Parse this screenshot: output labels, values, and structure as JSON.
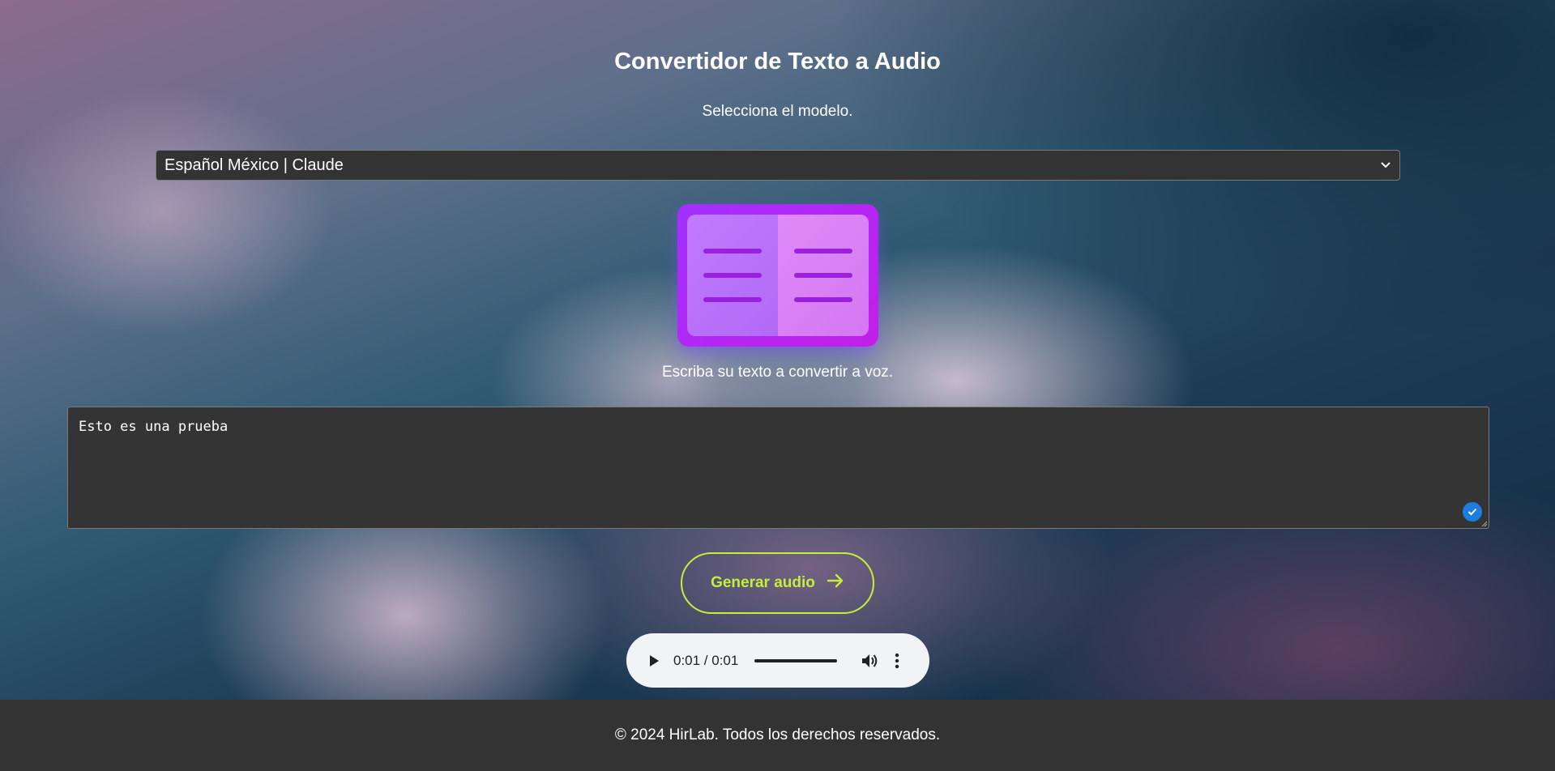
{
  "header": {
    "title": "Convertidor de Texto a Audio",
    "subtitle": "Selecciona el modelo."
  },
  "model_select": {
    "selected": "Español México | Claude",
    "icon": "chevron-down-icon"
  },
  "illustration": {
    "icon": "book-icon",
    "colors": {
      "cover": "#a330ff",
      "page_left": "#c17bff",
      "page_right": "#e08af8"
    }
  },
  "editor": {
    "label": "Escriba su texto a convertir a voz.",
    "value": "Esto es una prueba",
    "check_icon": "check-icon"
  },
  "generate_button": {
    "label": "Generar audio",
    "icon": "arrow-right-icon",
    "color": "#c5ef3a"
  },
  "audio_player": {
    "time": "0:01 / 0:01",
    "progress": 1.0,
    "play_icon": "play-icon",
    "volume_icon": "volume-icon",
    "more_icon": "more-vert-icon"
  },
  "footer": {
    "text": "© 2024 HirLab. Todos los derechos reservados."
  }
}
